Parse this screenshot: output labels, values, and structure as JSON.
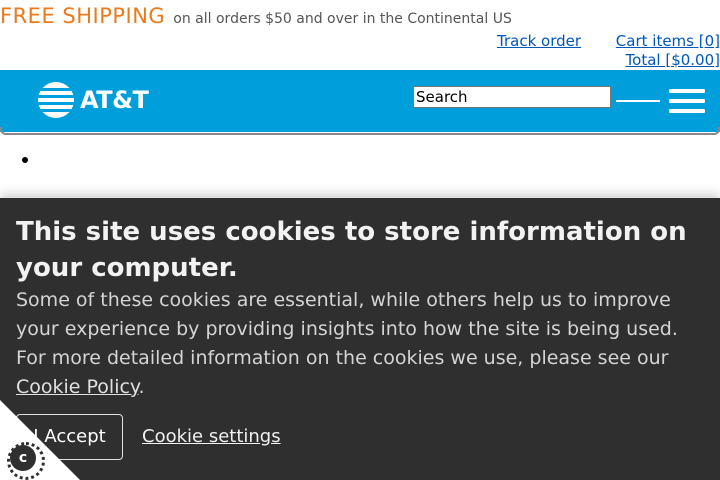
{
  "promo": {
    "headline": "FREE SHIPPING",
    "subtext": "on all orders $50 and over in the Continental US"
  },
  "account_links": {
    "track_order": "Track order",
    "cart_items": "Cart items [0]",
    "total": "Total [$0.00]"
  },
  "header": {
    "brand_text": "AT&T",
    "search_value": "Search",
    "background_color": "#009fdb"
  },
  "cookie_banner": {
    "title": "This site uses cookies to store information on your computer.",
    "body": "Some of these cookies are essential, while others help us to improve your experience by providing insights into how the site is being used. For more detailed information on the cookies we use, please see our",
    "policy_link": "Cookie Policy",
    "policy_suffix": ".",
    "accept_label": "I Accept",
    "settings_label": "Cookie settings",
    "corner_icon_letter": "c",
    "background_color": "#2f2f2f"
  },
  "accent_color": "#ec7a1c",
  "link_color": "#0057b8"
}
